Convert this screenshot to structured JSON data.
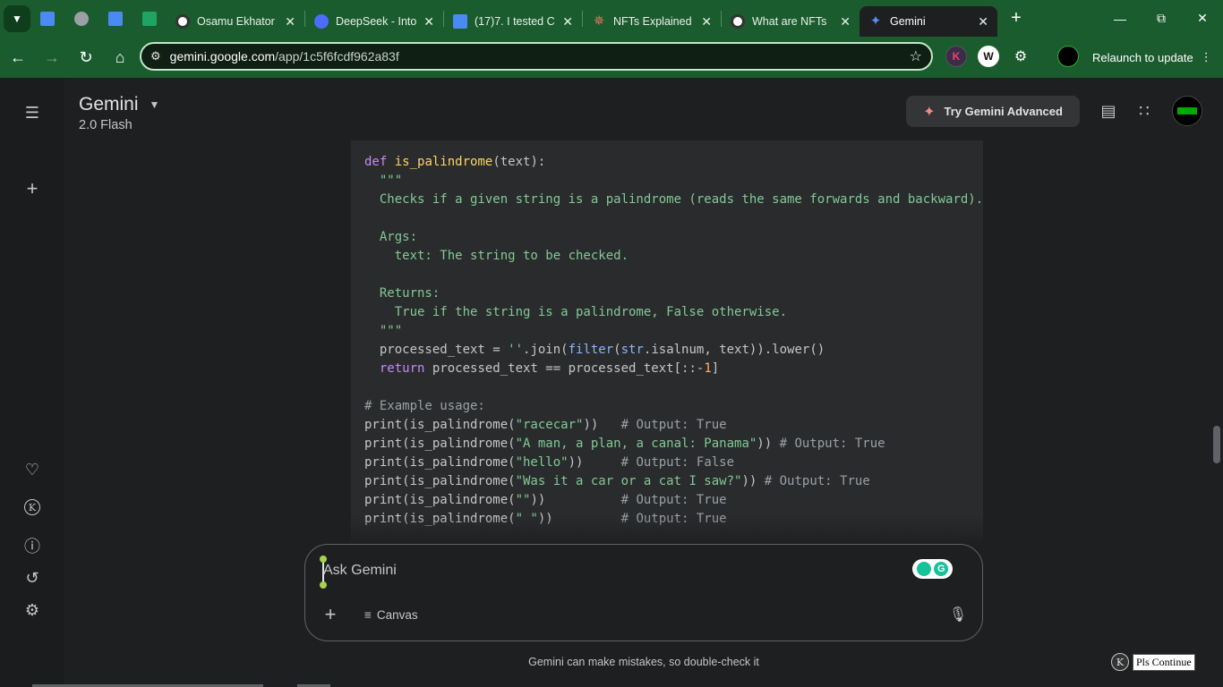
{
  "browser": {
    "tabs": [
      {
        "title": "Osamu Ekhator",
        "icon": "openai-icon"
      },
      {
        "title": "DeepSeek - Into",
        "icon": "deepseek-icon"
      },
      {
        "title": "(17)7. I tested C",
        "icon": "docs-icon"
      },
      {
        "title": "NFTs Explained",
        "icon": "claude-icon"
      },
      {
        "title": "What are NFTs",
        "icon": "openai-icon"
      },
      {
        "title": "Gemini",
        "icon": "gemini-icon"
      }
    ],
    "url_host": "gemini.google.com",
    "url_path": "/app/1c5f6fcdf962a83f",
    "relaunch_label": "Relaunch to update"
  },
  "app": {
    "title": "Gemini",
    "model": "2.0 Flash",
    "try_advanced_label": "Try Gemini Advanced"
  },
  "code": {
    "lines": [
      "def is_palindrome(text):",
      "  \"\"\"",
      "  Checks if a given string is a palindrome (reads the same forwards and backward).",
      "",
      "  Args:",
      "    text: The string to be checked.",
      "",
      "  Returns:",
      "    True if the string is a palindrome, False otherwise.",
      "  \"\"\"",
      "  processed_text = ''.join(filter(str.isalnum, text)).lower()",
      "  return processed_text == processed_text[::-1]",
      "",
      "# Example usage:",
      "print(is_palindrome(\"racecar\"))   # Output: True",
      "print(is_palindrome(\"A man, a plan, a canal: Panama\")) # Output: True",
      "print(is_palindrome(\"hello\"))     # Output: False",
      "print(is_palindrome(\"Was it a car or a cat I saw?\")) # Output: True",
      "print(is_palindrome(\"\"))          # Output: True",
      "print(is_palindrome(\" \"))         # Output: True"
    ]
  },
  "input": {
    "placeholder": "Ask Gemini",
    "canvas_label": "Canvas"
  },
  "footer": {
    "disclaimer": "Gemini can make mistakes, so double-check it",
    "pls_continue": "Pls Continue",
    "k_badge": "K"
  }
}
